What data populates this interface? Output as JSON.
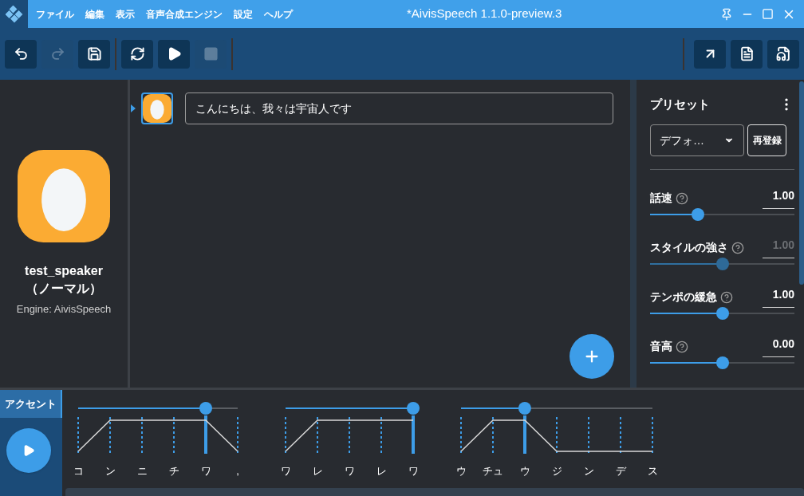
{
  "title_bar": {
    "menu": [
      "ファイル",
      "編集",
      "表示",
      "音声合成エンジン",
      "設定",
      "ヘルプ"
    ],
    "title": "*AivisSpeech 1.1.0-preview.3"
  },
  "toolbar": {
    "groups": [
      [
        {
          "kind": "undo",
          "disabled": false
        },
        {
          "kind": "redo",
          "disabled": true
        },
        {
          "kind": "save",
          "disabled": false
        }
      ],
      [
        {
          "kind": "continuous",
          "disabled": false
        },
        {
          "kind": "play",
          "disabled": false
        },
        {
          "kind": "stop",
          "disabled": true
        }
      ]
    ],
    "right": [
      {
        "kind": "export",
        "disabled": false
      },
      {
        "kind": "text_export",
        "disabled": false
      },
      {
        "kind": "audio_export",
        "disabled": false
      }
    ]
  },
  "character": {
    "name": "test_speaker",
    "style": "（ノーマル）",
    "engine": "Engine: AivisSpeech"
  },
  "audio_items": [
    {
      "text": "こんにちは、我々は宇宙人です",
      "selected": true
    }
  ],
  "preset": {
    "title": "プリセット",
    "value": "デフォ…",
    "register_button": "再登録"
  },
  "parameters": [
    {
      "label": "話速",
      "value": "1.00",
      "level": 0.33,
      "disabled": false
    },
    {
      "label": "スタイルの強さ",
      "value": "1.00",
      "level": 0.5,
      "disabled": true
    },
    {
      "label": "テンポの緩急",
      "value": "1.00",
      "level": 0.5,
      "disabled": false
    },
    {
      "label": "音高",
      "value": "0.00",
      "level": 0.5,
      "disabled": false
    }
  ],
  "accent": {
    "tab": "アクセント",
    "phrases": [
      {
        "moras": [
          "コ",
          "ン",
          "ニ",
          "チ",
          "ワ",
          ","
        ],
        "level": 0.8
      },
      {
        "moras": [
          "ワ",
          "レ",
          "ワ",
          "レ",
          "ワ"
        ],
        "level": 1
      },
      {
        "moras": [
          "ウ",
          "チュ",
          "ウ",
          "ジ",
          "ン",
          "デ",
          "ス"
        ],
        "level": 0.333
      }
    ]
  }
}
